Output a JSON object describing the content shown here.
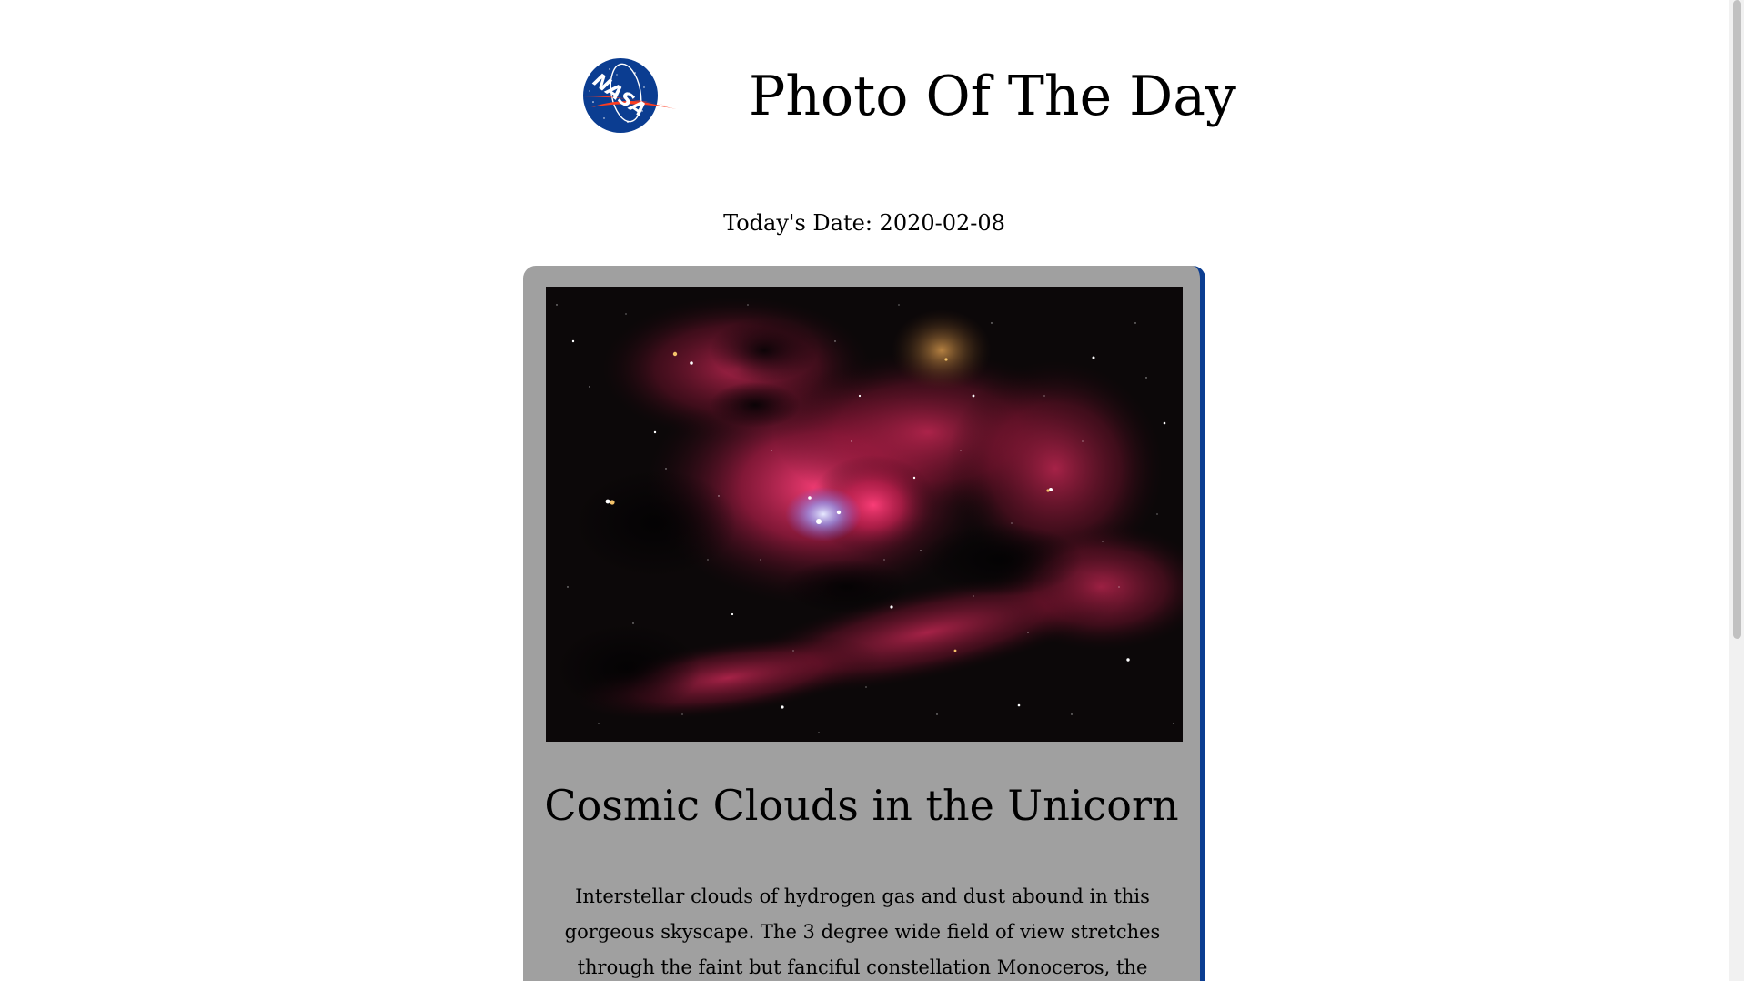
{
  "header": {
    "logo_text": "NASA",
    "title": "Photo Of The Day"
  },
  "date": {
    "label": "Today's Date: 2020-02-08"
  },
  "card": {
    "image_alt": "Cosmic Clouds in the Unicorn",
    "title": "Cosmic Clouds in the Unicorn",
    "explanation": "Interstellar clouds of hydrogen gas and dust abound in this gorgeous skyscape. The 3 degree wide field of view stretches through the faint but fanciful constellation Monoceros, the Unicorn. A star forming region cataloged as"
  },
  "colors": {
    "nasa_blue": "#0b3d91",
    "nasa_red": "#fc3d21",
    "card_background": "#a0a0a0"
  },
  "icons": {
    "logo": "nasa-meatball-logo"
  }
}
